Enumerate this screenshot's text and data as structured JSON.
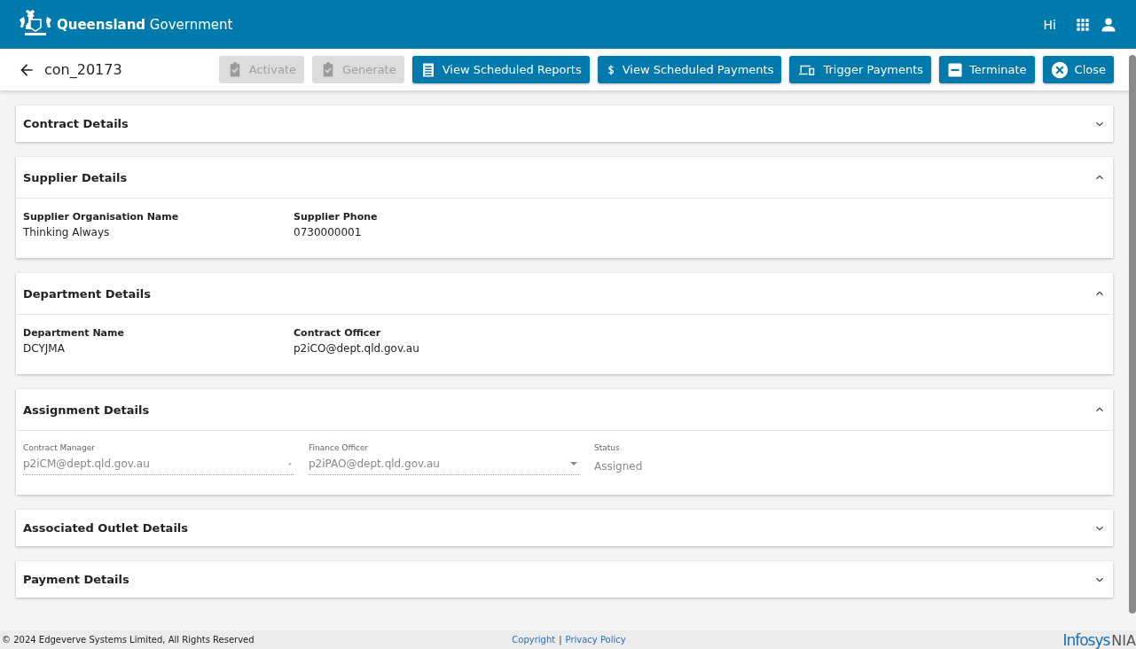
{
  "header": {
    "brand_bold": "Queensland",
    "brand_rest": "Government",
    "greeting": "Hi"
  },
  "toolbar": {
    "title": "con_20173",
    "buttons": [
      {
        "label": "Activate",
        "kind": "check",
        "disabled": true
      },
      {
        "label": "Generate",
        "kind": "check",
        "disabled": true
      },
      {
        "label": "View Scheduled Reports",
        "kind": "list",
        "disabled": false
      },
      {
        "label": "View Scheduled Payments",
        "kind": "dollar",
        "disabled": false
      },
      {
        "label": "Trigger Payments",
        "kind": "devices",
        "disabled": false
      },
      {
        "label": "Terminate",
        "kind": "minus",
        "disabled": false
      },
      {
        "label": "Close",
        "kind": "close",
        "disabled": false
      }
    ]
  },
  "sections": [
    {
      "title": "Contract Details",
      "expanded": false
    },
    {
      "title": "Supplier Details",
      "expanded": true,
      "fields": [
        {
          "kind": "text",
          "label": "Supplier Organisation Name",
          "value": "Thinking Always"
        },
        {
          "kind": "text",
          "label": "Supplier Phone",
          "value": "0730000001"
        }
      ]
    },
    {
      "title": "Department Details",
      "expanded": true,
      "fields": [
        {
          "kind": "text",
          "label": "Department Name",
          "value": "DCYJMA"
        },
        {
          "kind": "text",
          "label": "Contract Officer",
          "value": "p2iCO@dept.qld.gov.au"
        }
      ]
    },
    {
      "title": "Assignment Details",
      "expanded": true,
      "fields": [
        {
          "kind": "combo",
          "label": "Contract Manager",
          "value": "p2iCM@dept.qld.gov.au"
        },
        {
          "kind": "select",
          "label": "Finance Officer",
          "value": "p2iPAO@dept.qld.gov.au"
        },
        {
          "kind": "readonly",
          "label": "Status",
          "value": "Assigned"
        }
      ]
    },
    {
      "title": "Associated Outlet Details",
      "expanded": false
    },
    {
      "title": "Payment Details",
      "expanded": false
    }
  ],
  "footer": {
    "copyright": "© 2024 Edgeverve Systems Limited, All Rights Reserved",
    "links": [
      "Copyright",
      "Privacy Policy"
    ],
    "separator": "|",
    "logo_main": "Infosys",
    "logo_sub": "NIA"
  }
}
